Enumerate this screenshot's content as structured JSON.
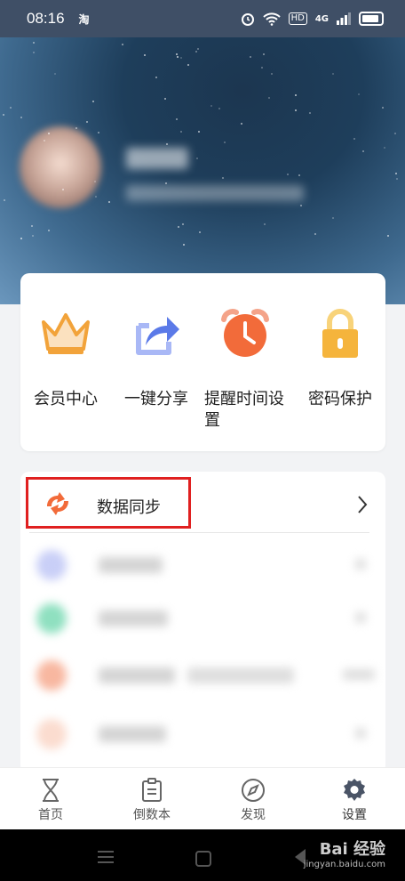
{
  "status_bar": {
    "time": "08:16",
    "app_badge": "淘",
    "hd_label": "HD",
    "network": "4G",
    "signal_bars": 3,
    "battery_level": 0.9
  },
  "features": [
    {
      "label": "会员中心",
      "icon": "crown-icon"
    },
    {
      "label": "一键分享",
      "icon": "share-icon"
    },
    {
      "label": "提醒时间设置",
      "icon": "alarm-clock-icon"
    },
    {
      "label": "密码保护",
      "icon": "lock-icon"
    }
  ],
  "list": {
    "sync_label": "数据同步",
    "sync_icon": "sync-icon"
  },
  "tabbar": [
    {
      "label": "首页",
      "icon": "hourglass-icon"
    },
    {
      "label": "倒数本",
      "icon": "clipboard-icon"
    },
    {
      "label": "发现",
      "icon": "compass-icon"
    },
    {
      "label": "设置",
      "icon": "gear-icon",
      "active": true
    }
  ],
  "watermark": {
    "brand": "Bai 经验",
    "url": "jingyan.baidu.com"
  },
  "colors": {
    "accent_orange": "#f26b3a",
    "crown_orange": "#f2a33a",
    "share_blue": "#6f8ef0",
    "lock_yellow": "#f5b43c",
    "highlight_red": "#e02020"
  }
}
